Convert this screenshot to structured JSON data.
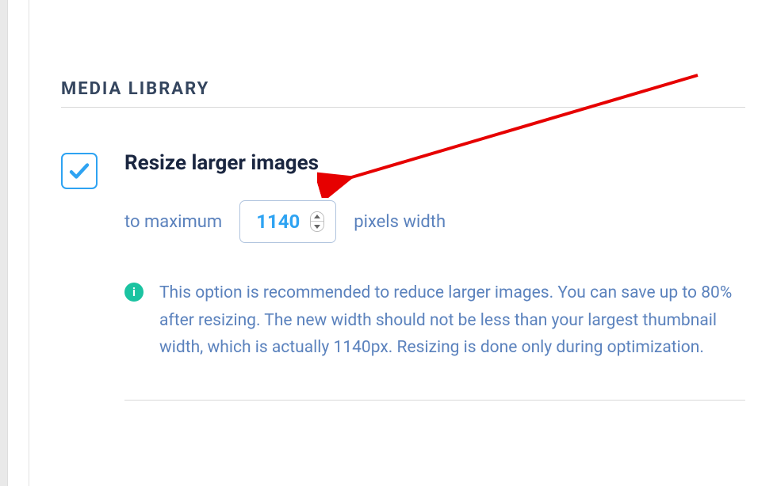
{
  "section": {
    "title": "MEDIA LIBRARY"
  },
  "option": {
    "label": "Resize larger images",
    "checked": true,
    "prefix_text": "to maximum",
    "width_value": "1140",
    "suffix_text": "pixels width"
  },
  "info": {
    "icon_letter": "i",
    "text": "This option is recommended to reduce larger images. You can save up to 80% after resizing. The new width should not be less than your largest thumbnail width, which is actually 1140px. Resizing is done only during optimization."
  }
}
